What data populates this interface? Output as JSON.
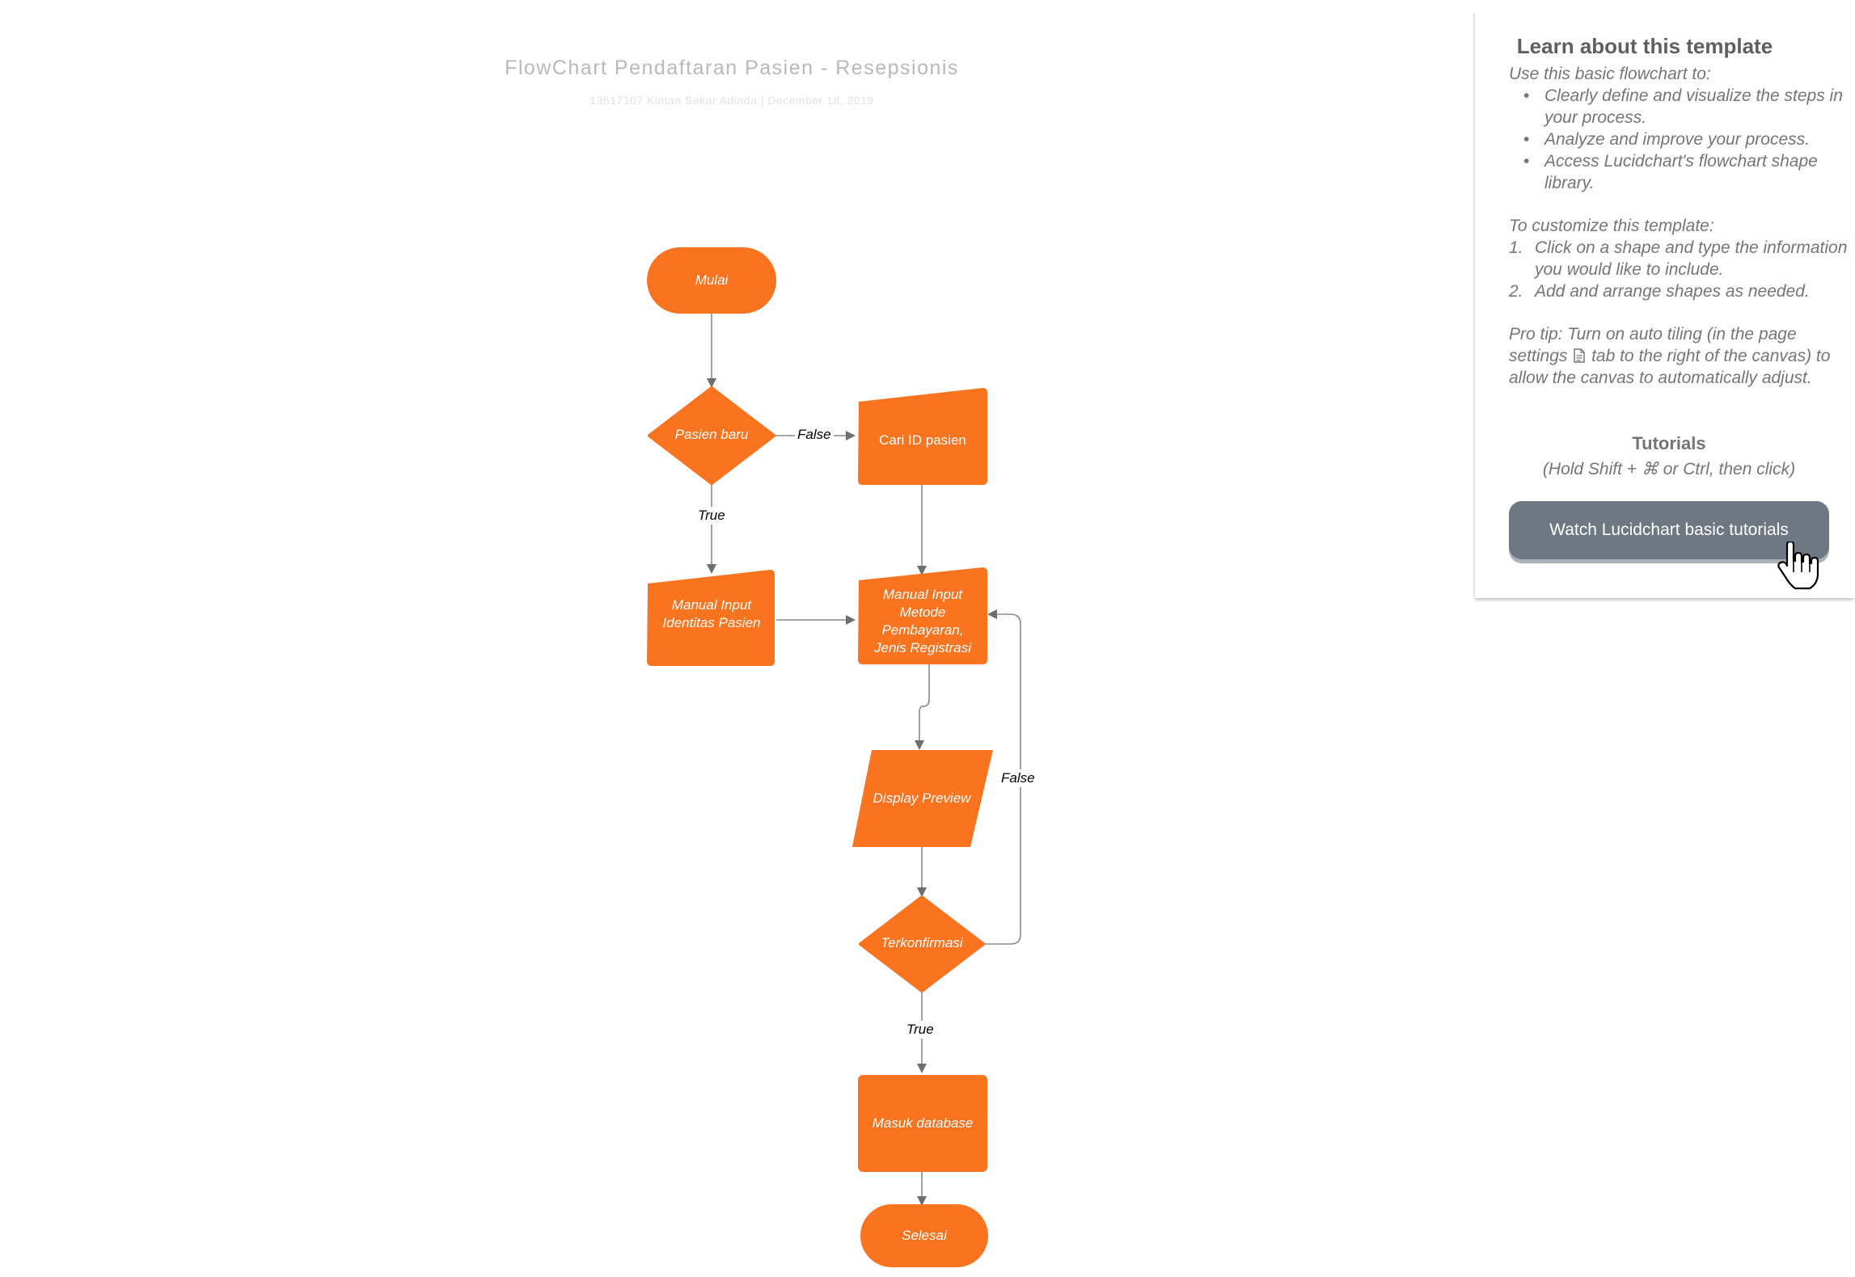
{
  "diagram": {
    "title": "FlowChart Pendaftaran Pasien - Resepsionis",
    "subtitle": "13517107 Kintan Sekar Adinda  |  December 18, 2019",
    "colors": {
      "node_fill": "#fa7420",
      "connector": "#6e6e6e",
      "text_on_node": "#ffffff"
    },
    "nodes": {
      "mulai": "Mulai",
      "pasien_baru": "Pasien baru",
      "cari_id": "Cari ID pasien",
      "manual_identitas": "Manual Input Identitas Pasien",
      "manual_metode": "Manual Input Metode Pembayaran, Jenis Registrasi",
      "display_preview": "Display Preview",
      "terkonfirmasi": "Terkonfirmasi",
      "masuk_database": "Masuk database",
      "selesai": "Selesai"
    },
    "edge_labels": {
      "pasien_false": "False",
      "pasien_true": "True",
      "konfirmasi_false": "False",
      "konfirmasi_true": "True"
    }
  },
  "panel": {
    "title": "Learn about this template",
    "intro": "Use this basic flowchart to:",
    "bullets": [
      "Clearly define and visualize the steps in your process.",
      "Analyze and improve your process.",
      "Access Lucidchart's flowchart shape library."
    ],
    "customize_intro": "To customize this template:",
    "steps": [
      {
        "num": "1.",
        "text": "Click on a shape and type the information you would like to include."
      },
      {
        "num": "2.",
        "text": "Add and arrange shapes as needed."
      }
    ],
    "pro_tip_before": "Pro tip: Turn on auto tiling (in the page settings",
    "pro_tip_after": "tab to the right of the canvas) to allow the canvas to automatically adjust.",
    "tutorials_title": "Tutorials",
    "tutorials_hint": "(Hold Shift + ⌘ or Ctrl, then click)",
    "watch_button": "Watch Lucidchart basic tutorials",
    "icons": [
      "page-settings-icon",
      "hand-pointer-icon"
    ]
  }
}
